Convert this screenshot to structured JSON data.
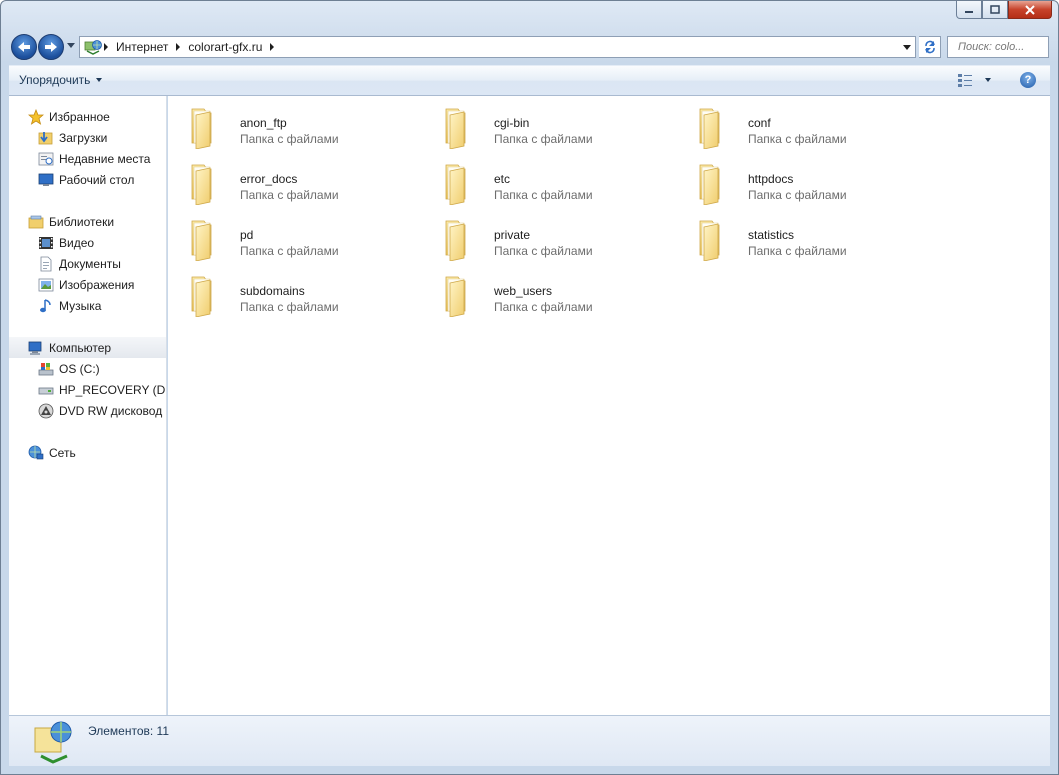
{
  "address": {
    "crumbs": [
      "Интернет",
      "colorart-gfx.ru"
    ],
    "search_placeholder": "Поиск: colo..."
  },
  "toolbar": {
    "organize_label": "Упорядочить",
    "help_label": "?"
  },
  "nav_pane": {
    "favorites": {
      "label": "Избранное",
      "items": [
        "Загрузки",
        "Недавние места",
        "Рабочий стол"
      ]
    },
    "libraries": {
      "label": "Библиотеки",
      "items": [
        "Видео",
        "Документы",
        "Изображения",
        "Музыка"
      ]
    },
    "computer": {
      "label": "Компьютер",
      "items": [
        "OS (C:)",
        "HP_RECOVERY (D:)",
        "DVD RW дисковод (E:)"
      ]
    },
    "network": {
      "label": "Сеть"
    }
  },
  "folders": [
    {
      "name": "anon_ftp",
      "type": "Папка с файлами"
    },
    {
      "name": "cgi-bin",
      "type": "Папка с файлами"
    },
    {
      "name": "conf",
      "type": "Папка с файлами"
    },
    {
      "name": "error_docs",
      "type": "Папка с файлами"
    },
    {
      "name": "etc",
      "type": "Папка с файлами"
    },
    {
      "name": "httpdocs",
      "type": "Папка с файлами"
    },
    {
      "name": "pd",
      "type": "Папка с файлами"
    },
    {
      "name": "private",
      "type": "Папка с файлами"
    },
    {
      "name": "statistics",
      "type": "Папка с файлами"
    },
    {
      "name": "subdomains",
      "type": "Папка с файлами"
    },
    {
      "name": "web_users",
      "type": "Папка с файлами"
    }
  ],
  "status": {
    "text": "Элементов: 11"
  },
  "colors": {
    "window_frame": "#c8d8ea",
    "folder_yellow": "#f5d77a",
    "status_text": "#1e3957"
  }
}
